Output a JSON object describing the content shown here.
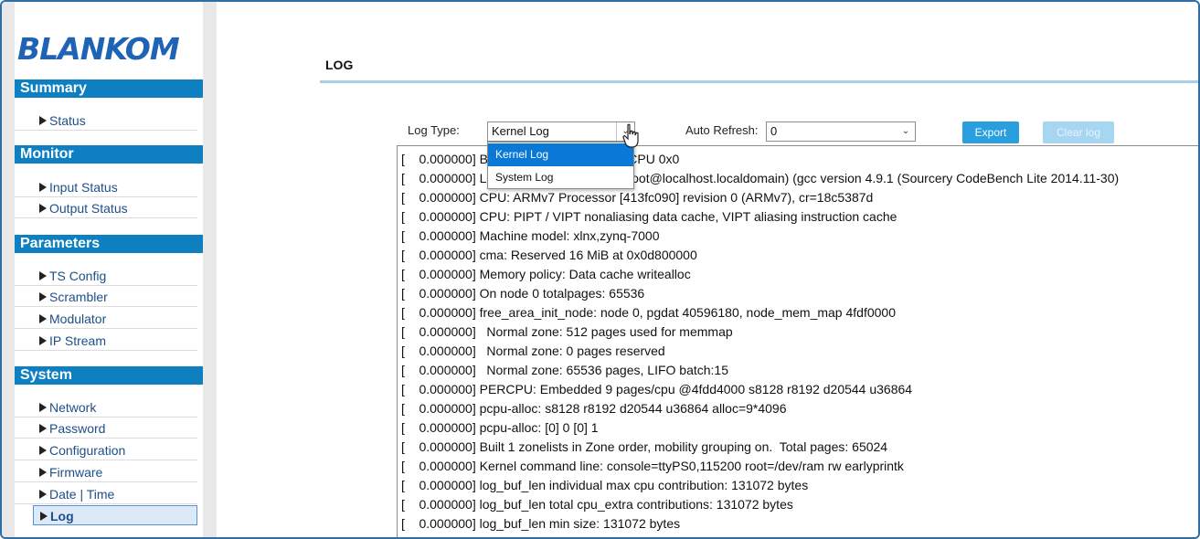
{
  "sidebar": {
    "logo": "BLANKOM",
    "sections": {
      "summary": {
        "title": "Summary",
        "items": [
          "Status"
        ]
      },
      "monitor": {
        "title": "Monitor",
        "items": [
          "Input Status",
          "Output Status"
        ]
      },
      "parameters": {
        "title": "Parameters",
        "items": [
          "TS Config",
          "Scrambler",
          "Modulator",
          "IP Stream"
        ]
      },
      "system": {
        "title": "System",
        "items": [
          "Network",
          "Password",
          "Configuration",
          "Firmware",
          "Date | Time",
          "Log"
        ]
      }
    },
    "active_item": "Log"
  },
  "main": {
    "title": "LOG",
    "log_type_label": "Log Type:",
    "log_type_value": "Kernel Log",
    "auto_refresh_label": "Auto Refresh:",
    "auto_refresh_value": "0",
    "export_label": "Export",
    "clear_label": "Clear log",
    "dropdown_options": [
      "Kernel Log",
      "System Log"
    ],
    "dropdown_selected": "Kernel Log",
    "log_lines": [
      "[    0.000000] Booting Linux on physical CPU 0x0",
      "[    0.000000] Linux version 4.4.0-xilinx (root@localhost.localdomain) (gcc version 4.9.1 (Sourcery CodeBench Lite 2014.11-30)",
      "[    0.000000] CPU: ARMv7 Processor [413fc090] revision 0 (ARMv7), cr=18c5387d",
      "[    0.000000] CPU: PIPT / VIPT nonaliasing data cache, VIPT aliasing instruction cache",
      "[    0.000000] Machine model: xlnx,zynq-7000",
      "[    0.000000] cma: Reserved 16 MiB at 0x0d800000",
      "[    0.000000] Memory policy: Data cache writealloc",
      "[    0.000000] On node 0 totalpages: 65536",
      "[    0.000000] free_area_init_node: node 0, pgdat 40596180, node_mem_map 4fdf0000",
      "[    0.000000]   Normal zone: 512 pages used for memmap",
      "[    0.000000]   Normal zone: 0 pages reserved",
      "[    0.000000]   Normal zone: 65536 pages, LIFO batch:15",
      "[    0.000000] PERCPU: Embedded 9 pages/cpu @4fdd4000 s8128 r8192 d20544 u36864",
      "[    0.000000] pcpu-alloc: s8128 r8192 d20544 u36864 alloc=9*4096",
      "[    0.000000] pcpu-alloc: [0] 0 [0] 1",
      "[    0.000000] Built 1 zonelists in Zone order, mobility grouping on.  Total pages: 65024",
      "[    0.000000] Kernel command line: console=ttyPS0,115200 root=/dev/ram rw earlyprintk",
      "[    0.000000] log_buf_len individual max cpu contribution: 131072 bytes",
      "[    0.000000] log_buf_len total cpu_extra contributions: 131072 bytes",
      "[    0.000000] log_buf_len min size: 131072 bytes"
    ]
  },
  "colors": {
    "section_bar": "#0e7fc1",
    "link": "#1e4f8a",
    "export_button": "#2a9fe0",
    "dropdown_highlight": "#0a78d7"
  }
}
